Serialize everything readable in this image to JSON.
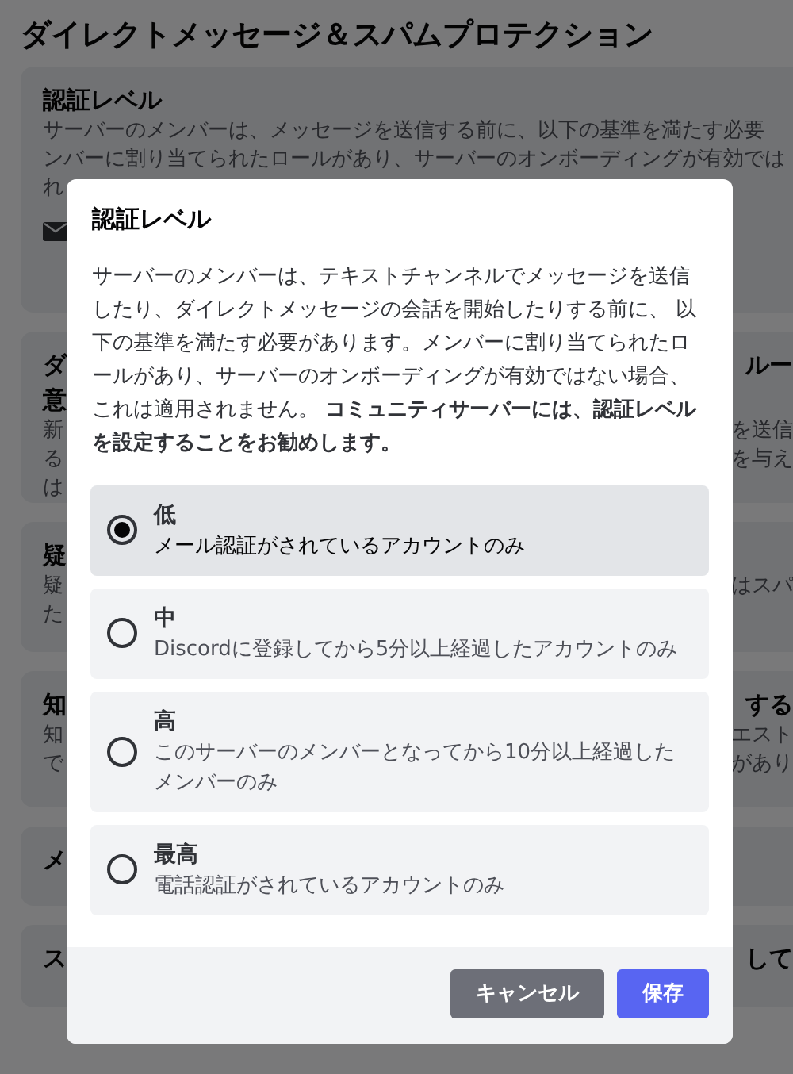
{
  "page": {
    "title": "ダイレクトメッセージ＆スパムプロテクション"
  },
  "cards": [
    {
      "kind": "full",
      "rows": [
        {
          "left": "認証レベル",
          "kind": "heading"
        },
        {
          "left": "サーバーのメンバーは、メッセージを送信する前に、以下の基準を満たす必要",
          "kind": "text"
        },
        {
          "left": "ンバーに割り当てられたロールがあり、サーバーのオンボーディングが有効では",
          "kind": "text"
        },
        {
          "left": "れ",
          "kind": "text"
        }
      ]
    },
    {
      "kind": "split",
      "rows": [
        {
          "left": "ダ",
          "right": "ルー",
          "kind": "heading"
        },
        {
          "left": "意",
          "kind": "heading"
        },
        {
          "left": "新",
          "right": "を送信",
          "kind": "text"
        },
        {
          "left": "る",
          "right": "を与え",
          "kind": "text"
        },
        {
          "left": "は",
          "kind": "text"
        }
      ]
    },
    {
      "kind": "split",
      "rows": [
        {
          "left": "疑",
          "kind": "heading"
        },
        {
          "left": "疑",
          "right": "はスパ",
          "kind": "text"
        },
        {
          "left": "た",
          "kind": "text"
        }
      ]
    },
    {
      "kind": "split",
      "rows": [
        {
          "left": "知",
          "right": "する",
          "kind": "heading"
        },
        {
          "left": "知",
          "right": "エスト",
          "kind": "text"
        },
        {
          "left": "で",
          "right": "があり",
          "kind": "text"
        }
      ]
    },
    {
      "kind": "split",
      "rows": [
        {
          "left": "メ",
          "kind": "heading"
        }
      ]
    },
    {
      "kind": "split",
      "rows": [
        {
          "left": "ス",
          "right": "して",
          "kind": "heading"
        }
      ]
    }
  ],
  "modal": {
    "title": "認証レベル",
    "description": "サーバーのメンバーは、テキストチャンネルでメッセージを送信したり、ダイレクトメッセージの会話を開始したりする前に、 以下の基準を満たす必要があります。メンバーに割り当てられたロールがあり、サーバーのオンボーディングが有効ではない場合、これは適用されません。 **コミュニティサーバーには、認証レベルを設定することをお勧めします。**",
    "options": [
      {
        "label": "低",
        "detail": "メール認証がされているアカウントのみ",
        "selected": true
      },
      {
        "label": "中",
        "detail": "Discordに登録してから5分以上経過したアカウントのみ",
        "selected": false
      },
      {
        "label": "高",
        "detail": "このサーバーのメンバーとなってから10分以上経過したメンバーのみ",
        "selected": false
      },
      {
        "label": "最高",
        "detail": "電話認証がされているアカウントのみ",
        "selected": false
      }
    ],
    "buttons": [
      {
        "kind": "secondary",
        "label": "キャンセル"
      },
      {
        "kind": "primary",
        "label": "保存"
      }
    ]
  }
}
